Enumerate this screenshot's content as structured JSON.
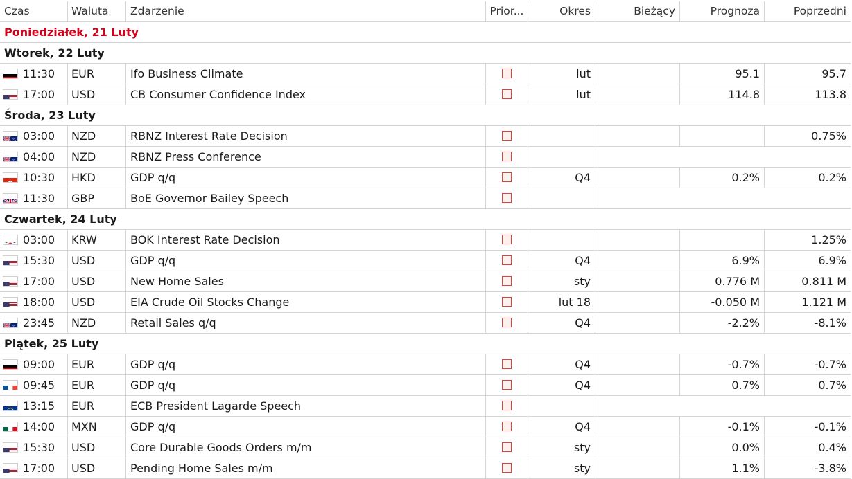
{
  "columns": {
    "time": "Czas",
    "currency": "Waluta",
    "event": "Zdarzenie",
    "priority": "Prior...",
    "period": "Okres",
    "actual": "Bieżący",
    "forecast": "Prognoza",
    "previous": "Poprzedni"
  },
  "colors": {
    "today_heading": "#d0021b",
    "priority_border": "#e0433c",
    "grid": "#d4d4d4"
  },
  "days": [
    {
      "title": "Poniedziałek, 21 Luty",
      "today": true,
      "events": []
    },
    {
      "title": "Wtorek, 22 Luty",
      "events": [
        {
          "flag": "de",
          "time": "11:30",
          "currency": "EUR",
          "event": "Ifo Business Climate",
          "period": "lut",
          "actual": "",
          "forecast": "95.1",
          "previous": "95.7"
        },
        {
          "flag": "us",
          "time": "17:00",
          "currency": "USD",
          "event": "CB Consumer Confidence Index",
          "period": "lut",
          "actual": "",
          "forecast": "114.8",
          "previous": "113.8"
        }
      ]
    },
    {
      "title": "Środa, 23 Luty",
      "events": [
        {
          "flag": "nz",
          "time": "03:00",
          "currency": "NZD",
          "event": "RBNZ Interest Rate Decision",
          "period": "",
          "actual": "",
          "forecast": "",
          "previous": "0.75%"
        },
        {
          "flag": "nz",
          "time": "04:00",
          "currency": "NZD",
          "event": "RBNZ Press Conference",
          "merged": true
        },
        {
          "flag": "hk",
          "time": "10:30",
          "currency": "HKD",
          "event": "GDP q/q",
          "period": "Q4",
          "actual": "",
          "forecast": "0.2%",
          "previous": "0.2%"
        },
        {
          "flag": "gb",
          "time": "11:30",
          "currency": "GBP",
          "event": "BoE Governor Bailey Speech",
          "merged": true
        }
      ]
    },
    {
      "title": "Czwartek, 24 Luty",
      "events": [
        {
          "flag": "kr",
          "time": "03:00",
          "currency": "KRW",
          "event": "BOK Interest Rate Decision",
          "period": "",
          "actual": "",
          "forecast": "",
          "previous": "1.25%"
        },
        {
          "flag": "us",
          "time": "15:30",
          "currency": "USD",
          "event": "GDP q/q",
          "period": "Q4",
          "actual": "",
          "forecast": "6.9%",
          "previous": "6.9%"
        },
        {
          "flag": "us",
          "time": "17:00",
          "currency": "USD",
          "event": "New Home Sales",
          "period": "sty",
          "actual": "",
          "forecast": "0.776 M",
          "previous": "0.811 M"
        },
        {
          "flag": "us",
          "time": "18:00",
          "currency": "USD",
          "event": "EIA Crude Oil Stocks Change",
          "period": "lut 18",
          "actual": "",
          "forecast": "-0.050 M",
          "previous": "1.121 M"
        },
        {
          "flag": "nz",
          "time": "23:45",
          "currency": "NZD",
          "event": "Retail Sales q/q",
          "period": "Q4",
          "actual": "",
          "forecast": "-2.2%",
          "previous": "-8.1%"
        }
      ]
    },
    {
      "title": "Piątek, 25 Luty",
      "events": [
        {
          "flag": "de",
          "time": "09:00",
          "currency": "EUR",
          "event": "GDP q/q",
          "period": "Q4",
          "actual": "",
          "forecast": "-0.7%",
          "previous": "-0.7%"
        },
        {
          "flag": "fr",
          "time": "09:45",
          "currency": "EUR",
          "event": "GDP q/q",
          "period": "Q4",
          "actual": "",
          "forecast": "0.7%",
          "previous": "0.7%"
        },
        {
          "flag": "eu",
          "time": "13:15",
          "currency": "EUR",
          "event": "ECB President Lagarde Speech",
          "merged": true
        },
        {
          "flag": "mx",
          "time": "14:00",
          "currency": "MXN",
          "event": "GDP q/q",
          "period": "Q4",
          "actual": "",
          "forecast": "-0.1%",
          "previous": "-0.1%"
        },
        {
          "flag": "us",
          "time": "15:30",
          "currency": "USD",
          "event": "Core Durable Goods Orders m/m",
          "period": "sty",
          "actual": "",
          "forecast": "0.0%",
          "previous": "0.4%"
        },
        {
          "flag": "us",
          "time": "17:00",
          "currency": "USD",
          "event": "Pending Home Sales m/m",
          "period": "sty",
          "actual": "",
          "forecast": "1.1%",
          "previous": "-3.8%"
        }
      ]
    }
  ]
}
